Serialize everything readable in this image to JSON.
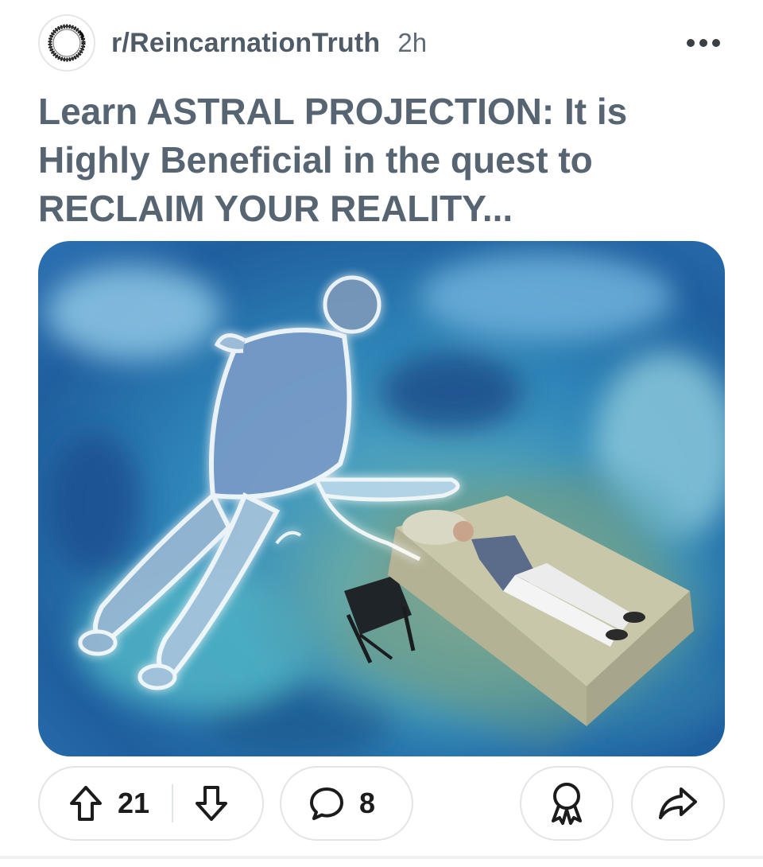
{
  "post": {
    "subreddit": "r/ReincarnationTruth",
    "age": "2h",
    "title": "Learn ASTRAL PROJECTION: It is Highly Beneficial in the quest to RECLAIM YOUR REALITY...",
    "more_icon": "more-horizontal-icon"
  },
  "media": {
    "description_icon": "image"
  },
  "actions": {
    "upvotes": "21",
    "comments": "8",
    "upvote_icon": "arrow-up-icon",
    "downvote_icon": "arrow-down-icon",
    "comment_icon": "speech-bubble-icon",
    "award_icon": "award-ribbon-icon",
    "share_icon": "share-arrow-icon"
  },
  "colors": {
    "title": "#576471",
    "meta": "#5f6b76",
    "count": "#1c1c1c",
    "border": "#e2e5e8"
  }
}
